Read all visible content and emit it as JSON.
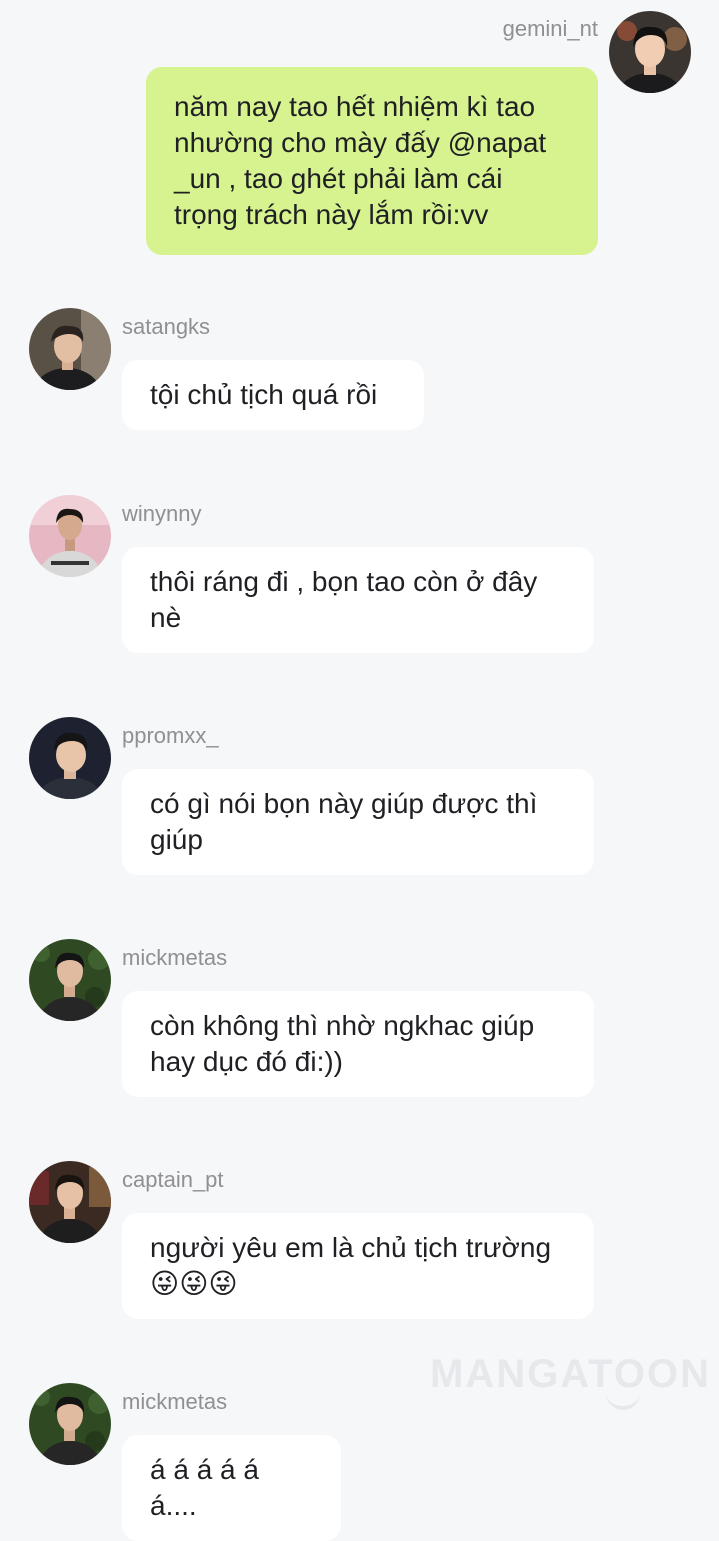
{
  "messages": [
    {
      "user": "gemini_nt",
      "text": "năm nay tao hết nhiệm kì tao nhường cho mày đấy @napat _un , tao ghét phải làm cái trọng trách này lắm rồi:vv"
    },
    {
      "user": "satangks",
      "text": "tội chủ tịch quá rồi"
    },
    {
      "user": "winynny",
      "text": "thôi ráng đi , bọn tao còn ở đây nè"
    },
    {
      "user": "ppromxx_",
      "text": "có gì nói bọn này giúp được thì giúp"
    },
    {
      "user": "mickmetas",
      "text": "còn không thì nhờ ngkhac giúp hay dục đó đi:))"
    },
    {
      "user": "captain_pt",
      "text": "người yêu em là chủ tịch trường 😜😜😜"
    },
    {
      "user": "mickmetas",
      "text": "á á á á á á...."
    }
  ],
  "avatars": [
    {
      "icon": "avatar-photo",
      "bg": "#3a3530",
      "shirt": "#1b1b1d"
    },
    {
      "icon": "avatar-photo",
      "bg": "#5a5146",
      "shirt": "#1d1d20"
    },
    {
      "icon": "avatar-photo",
      "bg": "#e6b8c4",
      "shirt": "#d8d8d8"
    },
    {
      "icon": "avatar-photo",
      "bg": "#1e2230",
      "shirt": "#2a2f3a"
    },
    {
      "icon": "avatar-photo",
      "bg": "#2f4a22",
      "shirt": "#262626"
    },
    {
      "icon": "avatar-photo",
      "bg": "#3b2a22",
      "shirt": "#1e1e1e"
    },
    {
      "icon": "avatar-photo",
      "bg": "#2f4a22",
      "shirt": "#262626"
    }
  ],
  "colors": {
    "background": "#f6f7f9",
    "outgoing_bubble": "#d6f38f",
    "incoming_bubble": "#ffffff",
    "username": "#8f8f94",
    "text": "#1f1f24"
  },
  "watermark": "MANGATOON"
}
